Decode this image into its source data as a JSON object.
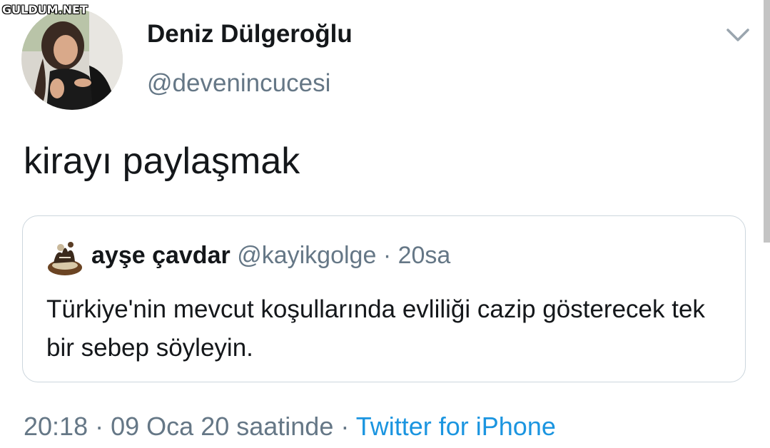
{
  "watermark": "GULDUM.NET",
  "author": {
    "display_name": "Deniz Dülgeroğlu",
    "handle": "@devenincucesi"
  },
  "menu_icon": "chevron-down-icon",
  "tweet": {
    "text": "kirayı paylaşmak"
  },
  "quoted_tweet": {
    "display_name": "ayşe çavdar",
    "handle": "@kayikgolge",
    "separator": "·",
    "time": "20sa",
    "text": "Türkiye'nin mevcut koşullarında evliliği cazip gösterecek tek bir sebep söyleyin."
  },
  "meta": {
    "time": "20:18",
    "separator1": "·",
    "date": "09 Oca 20 saatinde",
    "separator2": "·",
    "source": "Twitter for iPhone"
  },
  "colors": {
    "text": "#14171a",
    "secondary": "#657786",
    "link": "#1b95e0",
    "border": "#ccd6dd"
  }
}
